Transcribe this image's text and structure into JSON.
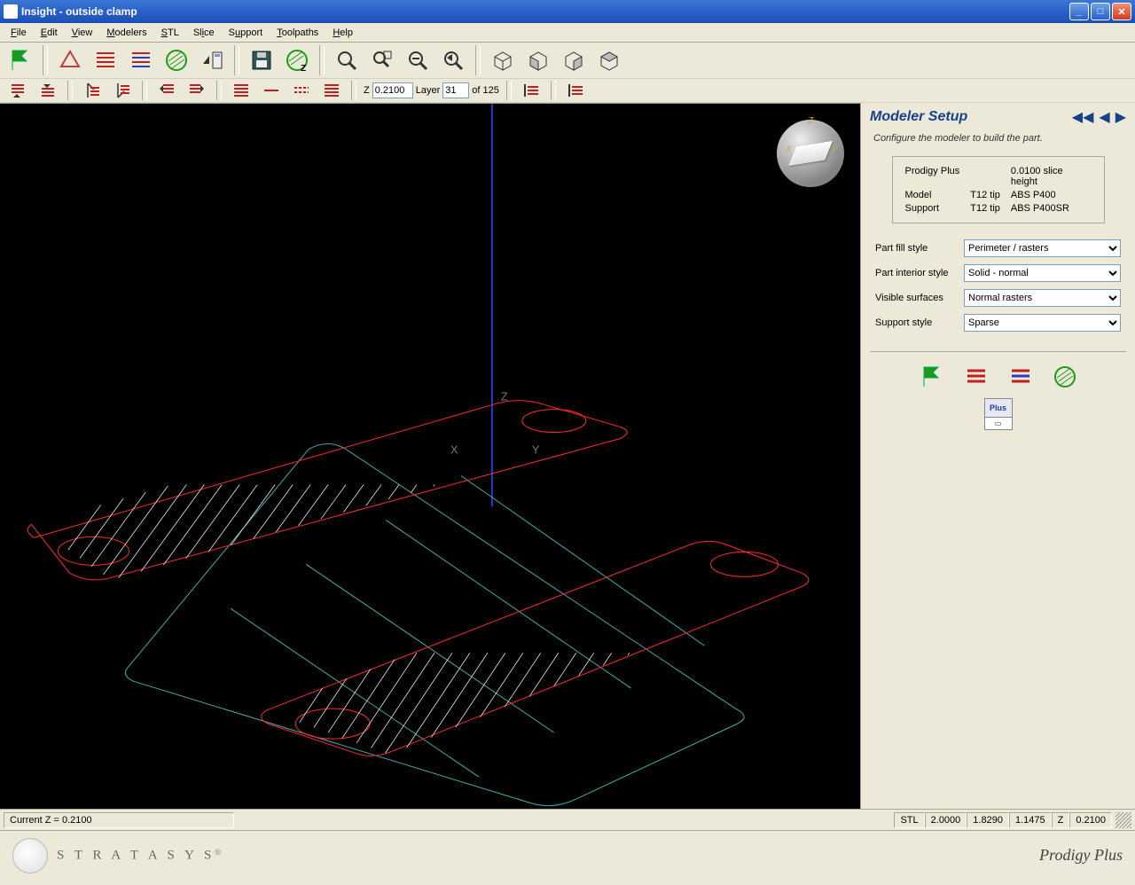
{
  "title": "Insight - outside clamp",
  "menu": [
    "File",
    "Edit",
    "View",
    "Modelers",
    "STL",
    "Slice",
    "Support",
    "Toolpaths",
    "Help"
  ],
  "z_controls": {
    "z_label": "Z",
    "z_value": "0.2100",
    "layer_label": "Layer",
    "layer_value": "31",
    "of_label": "of",
    "total_layers": "125"
  },
  "status": {
    "currentZ": "Current Z = 0.2100",
    "stl": "STL",
    "dims": [
      "2.0000",
      "1.8290",
      "1.1475"
    ],
    "zlabel": "Z",
    "zval": "0.2100"
  },
  "sidebar": {
    "title": "Modeler Setup",
    "subtitle": "Configure the modeler to build the part.",
    "info": {
      "row1": {
        "a": "Prodigy Plus",
        "b": "",
        "c": "0.0100 slice height"
      },
      "row2": {
        "a": "Model",
        "b": "T12 tip",
        "c": "ABS P400"
      },
      "row3": {
        "a": "Support",
        "b": "T12 tip",
        "c": "ABS P400SR"
      }
    },
    "fields": {
      "fill_label": "Part fill style",
      "fill_value": "Perimeter / rasters",
      "interior_label": "Part interior style",
      "interior_value": "Solid - normal",
      "visible_label": "Visible surfaces",
      "visible_value": "Normal rasters",
      "support_label": "Support style",
      "support_value": "Sparse"
    },
    "plus_label": "Plus"
  },
  "branding": {
    "company": "S T R A T A S Y S",
    "reg": "®",
    "product": "Prodigy Plus"
  },
  "triad": {
    "x": "X",
    "y": "Y",
    "z": "Z"
  }
}
